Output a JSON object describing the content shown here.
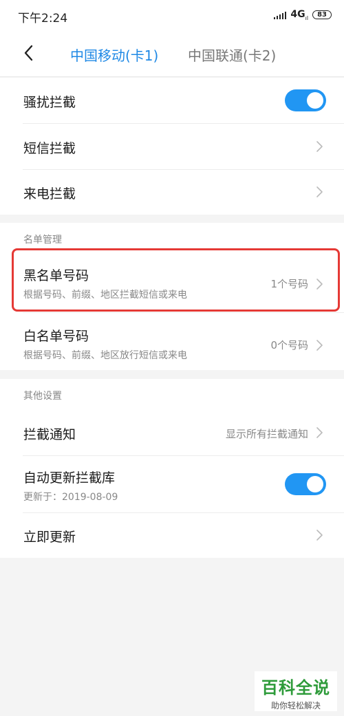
{
  "status": {
    "time": "下午2:24",
    "network": "4G",
    "network_sub": "ıl",
    "battery": "83"
  },
  "header": {
    "tab_active": "中国移动(卡1)",
    "tab_inactive": "中国联通(卡2)"
  },
  "section1": {
    "harass_label": "骚扰拦截",
    "harass_enabled": true,
    "sms_label": "短信拦截",
    "call_label": "来电拦截"
  },
  "list_management": {
    "header": "名单管理",
    "blacklist": {
      "title": "黑名单号码",
      "subtitle": "根据号码、前缀、地区拦截短信或来电",
      "value": "1个号码"
    },
    "whitelist": {
      "title": "白名单号码",
      "subtitle": "根据号码、前缀、地区放行短信或来电",
      "value": "0个号码"
    }
  },
  "other_settings": {
    "header": "其他设置",
    "notify": {
      "title": "拦截通知",
      "value": "显示所有拦截通知"
    },
    "auto_update": {
      "title": "自动更新拦截库",
      "subtitle": "更新于：2019-08-09",
      "enabled": true
    },
    "update_now": {
      "title": "立即更新"
    }
  },
  "watermark": {
    "main": "百科全说",
    "sub": "助你轻松解决"
  },
  "colors": {
    "accent": "#1e88e5",
    "toggle": "#2196f3",
    "highlight": "#e53935",
    "watermark": "#2e9b3a"
  }
}
